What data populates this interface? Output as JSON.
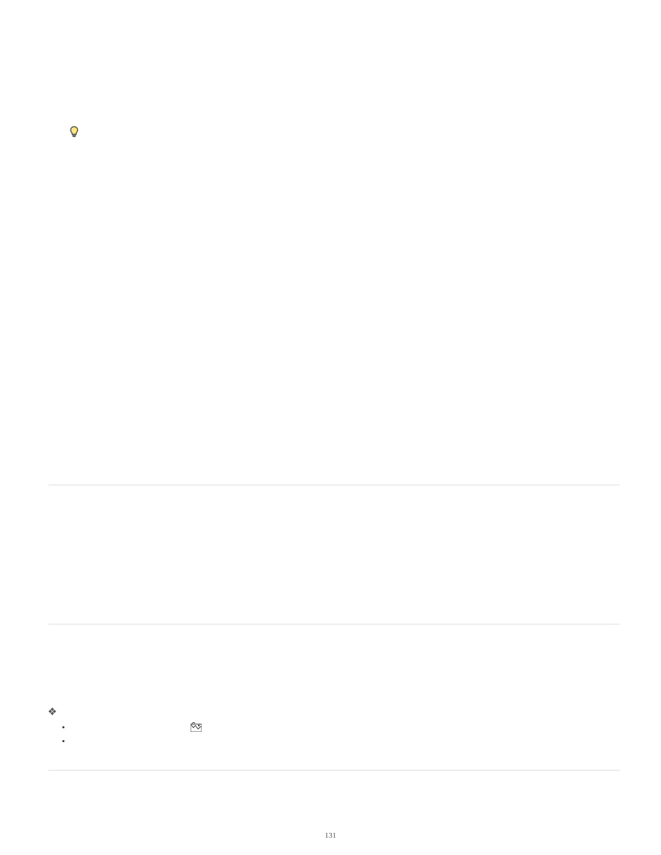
{
  "tip": {
    "icon_name": "lightbulb-icon"
  },
  "sections": [
    {},
    {}
  ],
  "procedure": {
    "marker_icon": "diamond-icon",
    "items": [
      {
        "inline_icon": "tool-icon"
      },
      {
        "inline_icon": null
      }
    ]
  },
  "page_number": "131"
}
